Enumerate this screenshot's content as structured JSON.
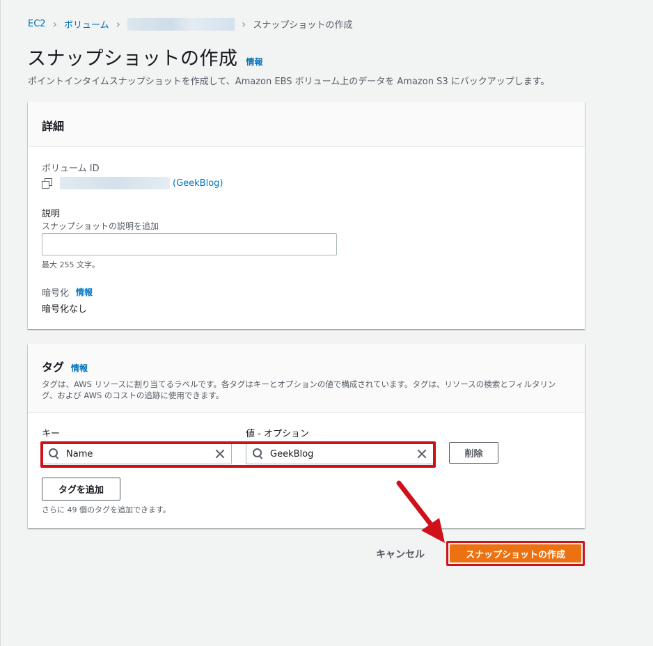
{
  "breadcrumb": {
    "items": [
      "EC2",
      "ボリューム"
    ],
    "current": "スナップショットの作成"
  },
  "page": {
    "title": "スナップショットの作成",
    "info": "情報",
    "description": "ポイントインタイムスナップショットを作成して、Amazon EBS ボリューム上のデータを Amazon S3 にバックアップします。"
  },
  "details": {
    "title": "詳細",
    "volume_id_label": "ボリューム ID",
    "volume_name": "(GeekBlog)",
    "description_label": "説明",
    "description_hint": "スナップショットの説明を追加",
    "description_value": "",
    "description_limit": "最大 255 文字。",
    "encryption_label": "暗号化",
    "encryption_info": "情報",
    "encryption_value": "暗号化なし"
  },
  "tags": {
    "title": "タグ",
    "info": "情報",
    "description": "タグは、AWS リソースに割り当てるラベルです。各タグはキーとオプションの値で構成されています。タグは、リソースの検索とフィルタリング、および AWS のコストの追跡に使用できます。",
    "key_header": "キー",
    "value_header": "値 - オプション",
    "rows": [
      {
        "key": "Name",
        "value": "GeekBlog"
      }
    ],
    "delete_label": "削除",
    "add_tag_label": "タグを追加",
    "remaining": "さらに 49 個のタグを追加できます。"
  },
  "footer": {
    "cancel_label": "キャンセル",
    "create_label": "スナップショットの作成"
  },
  "colors": {
    "accent": "#ec7211",
    "link": "#0073bb",
    "highlight": "#d0101b"
  }
}
